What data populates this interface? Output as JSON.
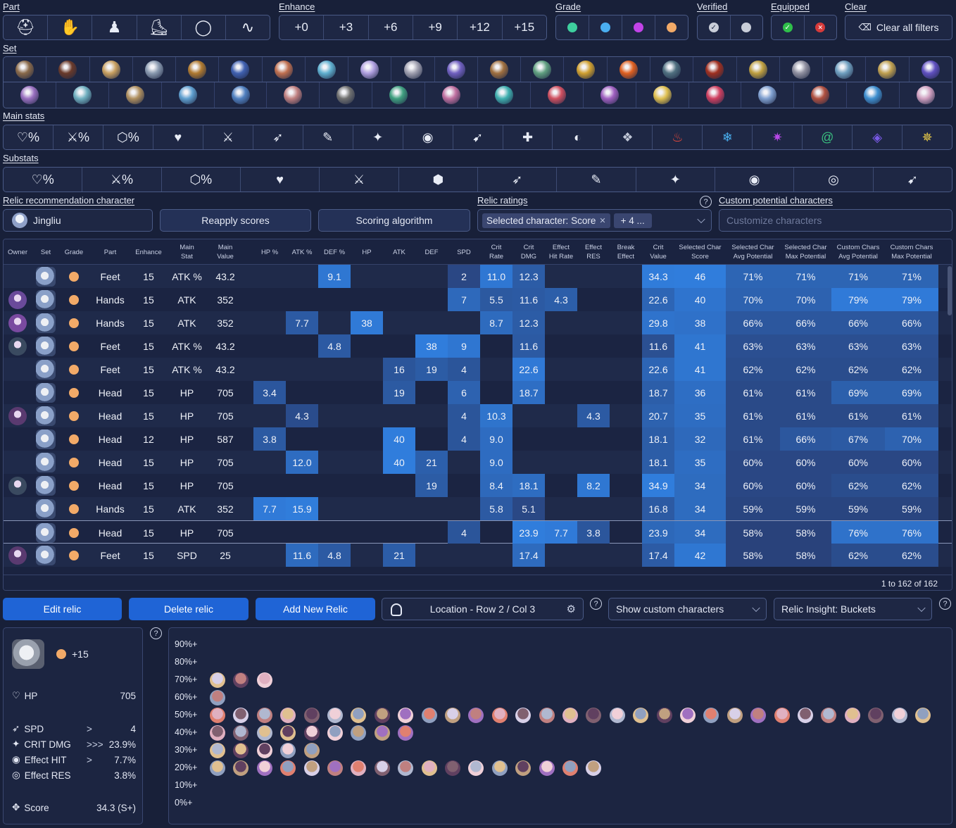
{
  "filters": {
    "part_label": "Part",
    "enhance_label": "Enhance",
    "grade_label": "Grade",
    "verified_label": "Verified",
    "equipped_label": "Equipped",
    "clear_label": "Clear",
    "part_icons": [
      "head-icon",
      "hands-icon",
      "body-icon",
      "feet-icon",
      "planar-sphere-icon",
      "link-rope-icon"
    ],
    "enhance": [
      "+0",
      "+3",
      "+6",
      "+9",
      "+12",
      "+15"
    ],
    "grades": [
      "#3ecf9e",
      "#4aaef0",
      "#c243e8",
      "#f2aa68"
    ],
    "clear_all": "Clear all filters",
    "set_label": "Set",
    "main_stats_label": "Main stats",
    "substats_label": "Substats"
  },
  "reco": {
    "label": "Relic recommendation character",
    "character": "Jingliu",
    "reapply": "Reapply scores",
    "scoring": "Scoring algorithm",
    "ratings_label": "Relic ratings",
    "chip": "Selected character: Score",
    "chip_more": "+ 4 ...",
    "custom_label": "Custom potential characters",
    "custom_placeholder": "Customize characters"
  },
  "grid": {
    "headers": [
      "Owner",
      "Set",
      "Grade",
      "Part",
      "Enhance",
      "Main\nStat",
      "Main\nValue",
      "HP %",
      "ATK %",
      "DEF %",
      "HP",
      "ATK",
      "DEF",
      "SPD",
      "Crit\nRate",
      "Crit\nDMG",
      "Effect\nHit Rate",
      "Effect\nRES",
      "Break\nEffect",
      "Crit\nValue",
      "Selected Char\nScore",
      "Selected Char\nAvg Potential",
      "Selected Char\nMax Potential",
      "Custom Chars\nAvg Potential",
      "Custom Chars\nMax Potential"
    ],
    "rows": [
      [
        "",
        "",
        "",
        "Feet",
        "15",
        "ATK %",
        "43.2",
        "",
        "",
        "9.1",
        "",
        "",
        "",
        "2",
        "11.0",
        "12.3",
        "",
        "",
        "",
        "34.3",
        "46",
        "71%",
        "71%",
        "71%",
        "71%"
      ],
      [
        "",
        "",
        "",
        "Hands",
        "15",
        "ATK",
        "352",
        "",
        "",
        "",
        "",
        "",
        "",
        "7",
        "5.5",
        "11.6",
        "4.3",
        "",
        "",
        "22.6",
        "40",
        "70%",
        "70%",
        "79%",
        "79%"
      ],
      [
        "",
        "",
        "",
        "Hands",
        "15",
        "ATK",
        "352",
        "",
        "7.7",
        "",
        "38",
        "",
        "",
        "",
        "8.7",
        "12.3",
        "",
        "",
        "",
        "29.8",
        "38",
        "66%",
        "66%",
        "66%",
        "66%"
      ],
      [
        "",
        "",
        "",
        "Feet",
        "15",
        "ATK %",
        "43.2",
        "",
        "",
        "4.8",
        "",
        "",
        "38",
        "9",
        "",
        "11.6",
        "",
        "",
        "",
        "11.6",
        "41",
        "63%",
        "63%",
        "63%",
        "63%"
      ],
      [
        "",
        "",
        "",
        "Feet",
        "15",
        "ATK %",
        "43.2",
        "",
        "",
        "",
        "",
        "16",
        "19",
        "4",
        "",
        "22.6",
        "",
        "",
        "",
        "22.6",
        "41",
        "62%",
        "62%",
        "62%",
        "62%"
      ],
      [
        "",
        "",
        "",
        "Head",
        "15",
        "HP",
        "705",
        "3.4",
        "",
        "",
        "",
        "19",
        "",
        "6",
        "",
        "18.7",
        "",
        "",
        "",
        "18.7",
        "36",
        "61%",
        "61%",
        "69%",
        "69%"
      ],
      [
        "",
        "",
        "",
        "Head",
        "15",
        "HP",
        "705",
        "",
        "4.3",
        "",
        "",
        "",
        "",
        "4",
        "10.3",
        "",
        "",
        "4.3",
        "",
        "20.7",
        "35",
        "61%",
        "61%",
        "61%",
        "61%"
      ],
      [
        "",
        "",
        "",
        "Head",
        "12",
        "HP",
        "587",
        "3.8",
        "",
        "",
        "",
        "40",
        "",
        "4",
        "9.0",
        "",
        "",
        "",
        "",
        "18.1",
        "32",
        "61%",
        "66%",
        "67%",
        "70%"
      ],
      [
        "",
        "",
        "",
        "Head",
        "15",
        "HP",
        "705",
        "",
        "12.0",
        "",
        "",
        "40",
        "21",
        "",
        "9.0",
        "",
        "",
        "",
        "",
        "18.1",
        "35",
        "60%",
        "60%",
        "60%",
        "60%"
      ],
      [
        "",
        "",
        "",
        "Head",
        "15",
        "HP",
        "705",
        "",
        "",
        "",
        "",
        "",
        "19",
        "",
        "8.4",
        "18.1",
        "",
        "8.2",
        "",
        "34.9",
        "34",
        "60%",
        "60%",
        "62%",
        "62%"
      ],
      [
        "",
        "",
        "",
        "Hands",
        "15",
        "ATK",
        "352",
        "7.7",
        "15.9",
        "",
        "",
        "",
        "",
        "",
        "5.8",
        "5.1",
        "",
        "",
        "",
        "16.8",
        "34",
        "59%",
        "59%",
        "59%",
        "59%"
      ],
      [
        "",
        "",
        "",
        "Head",
        "15",
        "HP",
        "705",
        "",
        "",
        "",
        "",
        "",
        "",
        "4",
        "",
        "23.9",
        "7.7",
        "3.8",
        "",
        "23.9",
        "34",
        "58%",
        "58%",
        "76%",
        "76%"
      ],
      [
        "",
        "",
        "",
        "Feet",
        "15",
        "SPD",
        "25",
        "",
        "11.6",
        "4.8",
        "",
        "21",
        "",
        "",
        "",
        "17.4",
        "",
        "",
        "",
        "17.4",
        "42",
        "58%",
        "58%",
        "62%",
        "62%"
      ]
    ],
    "owners": [
      false,
      true,
      true,
      true,
      false,
      false,
      true,
      false,
      false,
      true,
      false,
      false,
      true
    ],
    "footer": "1 to 162 of 162"
  },
  "actions": {
    "edit": "Edit relic",
    "delete": "Delete relic",
    "add": "Add New Relic",
    "location": "Location - Row 2 / Col 3",
    "show_custom": "Show custom characters",
    "insight": "Relic Insight: Buckets"
  },
  "relic": {
    "enhance": "+15",
    "main": {
      "stat": "HP",
      "value": "705"
    },
    "subs": [
      {
        "stat": "SPD",
        "rolls": ">",
        "value": "4"
      },
      {
        "stat": "CRIT DMG",
        "rolls": ">>>",
        "value": "23.9%"
      },
      {
        "stat": "Effect HIT",
        "rolls": ">",
        "value": "7.7%"
      },
      {
        "stat": "Effect RES",
        "rolls": "",
        "value": "3.8%"
      }
    ],
    "score_label": "Score",
    "score": "34.3 (S+)"
  },
  "chart_data": {
    "type": "scatter",
    "yticks": [
      "90%+",
      "80%+",
      "70%+",
      "60%+",
      "50%+",
      "40%+",
      "30%+",
      "20%+",
      "10%+",
      "0%+"
    ],
    "buckets": [
      {
        "bucket": "70%+",
        "count": 3
      },
      {
        "bucket": "60%+",
        "count": 1
      },
      {
        "bucket": "50%+",
        "count": 31
      },
      {
        "bucket": "40%+",
        "count": 9
      },
      {
        "bucket": "30%+",
        "count": 5
      },
      {
        "bucket": "20%+",
        "count": 17
      }
    ]
  }
}
